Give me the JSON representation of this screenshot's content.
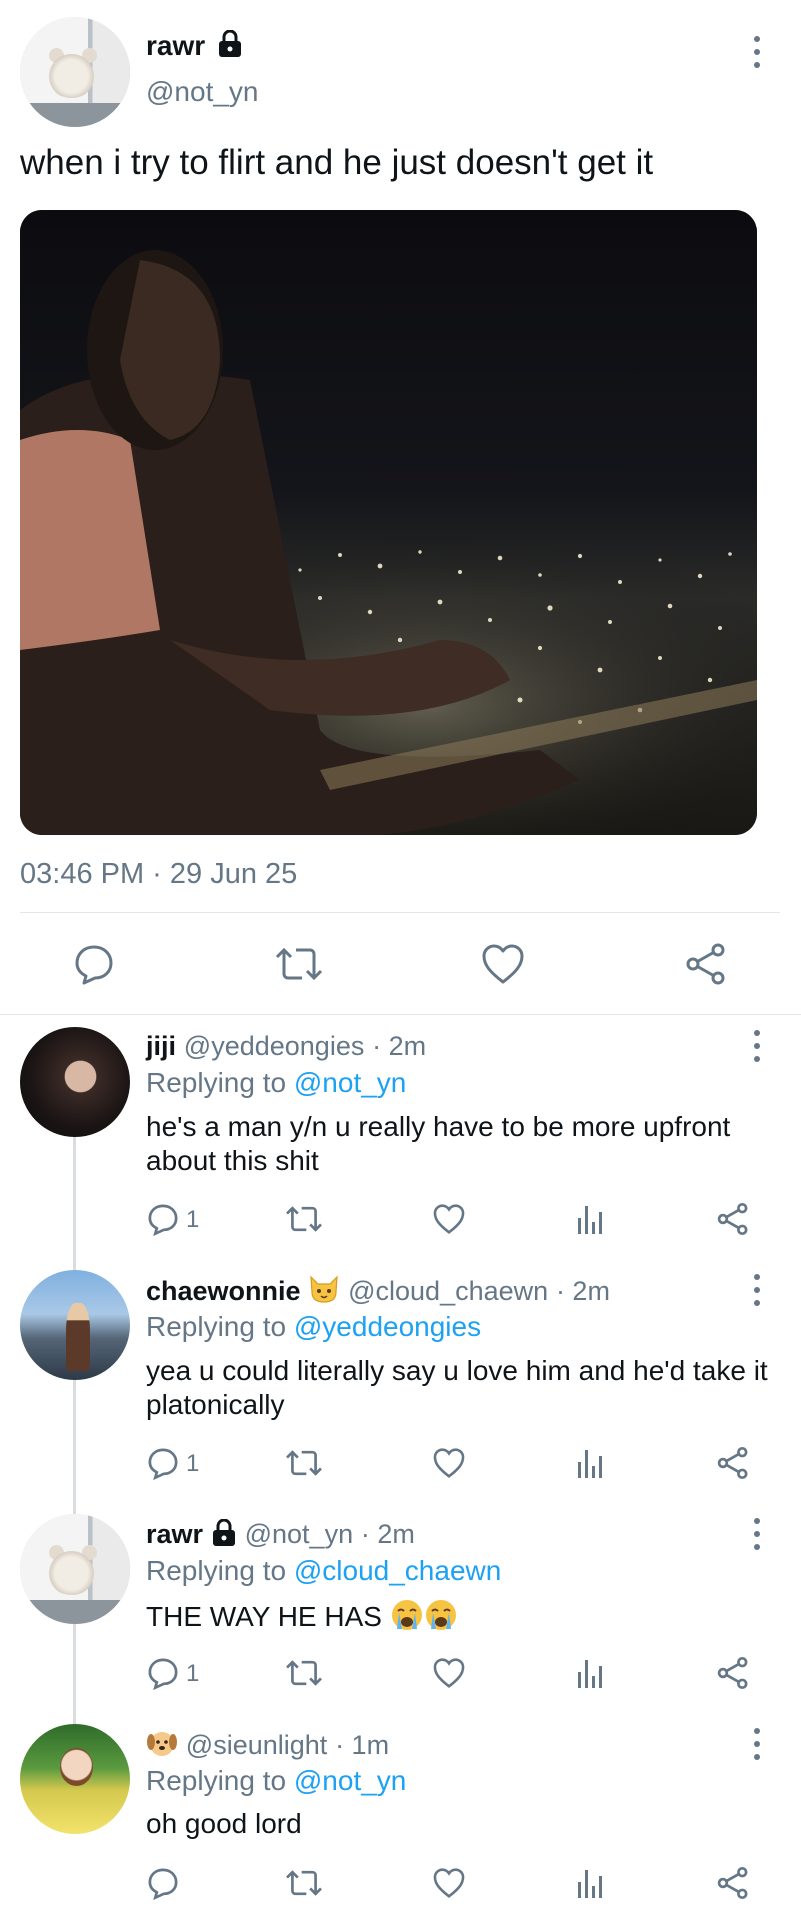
{
  "main_tweet": {
    "author_name": "rawr",
    "author_handle": "@not_yn",
    "text": "when i try to flirt and he just doesn't get it",
    "timestamp": "03:46 PM · 29 Jun 25",
    "image_icon": "photo-man-overlooking-city-lights",
    "lock_icon": "lock-icon"
  },
  "replies": [
    {
      "name": "jiji",
      "handle": "@yeddeongies",
      "time": "· 2m",
      "replying_prefix": "Replying to",
      "replying_to": "@not_yn",
      "text": "he's a man y/n u really have to be more upfront about this shit",
      "reply_count": "1"
    },
    {
      "name": "chaewonnie",
      "name_emoji": "cat-face-icon",
      "handle": "@cloud_chaewn",
      "time": "· 2m",
      "replying_prefix": "Replying to",
      "replying_to": "@yeddeongies",
      "text": "yea u could literally say u love him and he'd take it platonically",
      "reply_count": "1"
    },
    {
      "name": "rawr",
      "handle": "@not_yn",
      "time": "· 2m",
      "replying_prefix": "Replying to",
      "replying_to": "@cloud_chaewn",
      "text": "THE WAY HE HAS",
      "text_emoji": "loudly-crying-face-icon x2",
      "reply_count": "1"
    },
    {
      "name_emoji": "dog-face-icon",
      "handle": "@sieunlight",
      "time": "· 1m",
      "replying_prefix": "Replying to",
      "replying_to": "@not_yn",
      "text": "oh good lord",
      "reply_count": ""
    }
  ],
  "colors": {
    "text": "#0f1419",
    "muted": "#657786",
    "link": "#1da1f2",
    "divider": "#e1e8ed"
  }
}
